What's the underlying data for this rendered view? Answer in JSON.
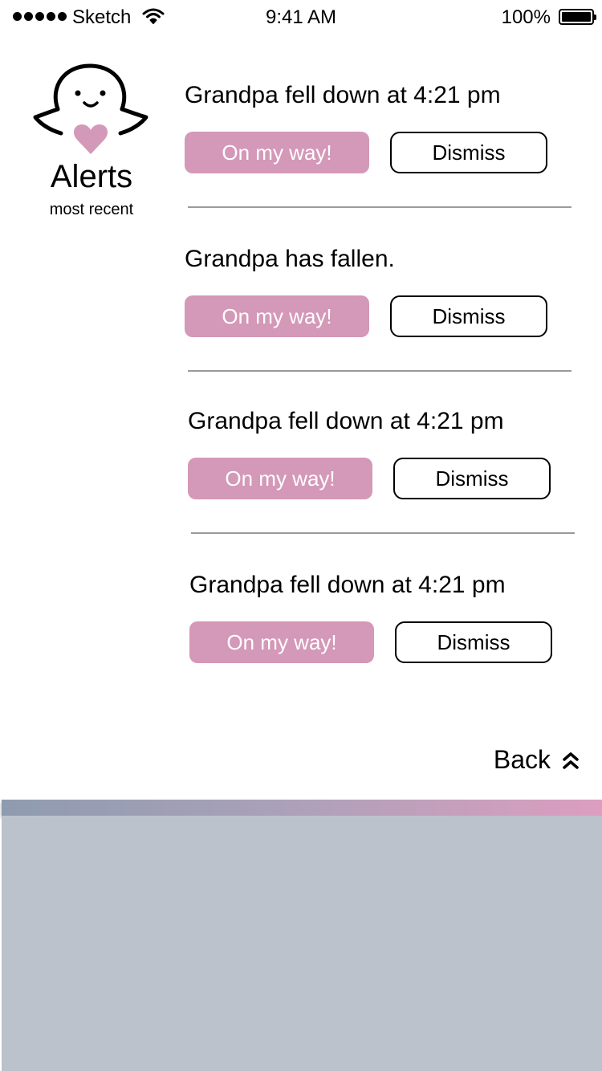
{
  "status_bar": {
    "carrier": "Sketch",
    "time": "9:41 AM",
    "battery": "100%"
  },
  "header": {
    "title": "Alerts",
    "subtitle": "most recent",
    "logo_icon": "ghost-heart-icon"
  },
  "alerts": [
    {
      "message": "Grandpa fell down at 4:21 pm",
      "primary_label": "On my way!",
      "secondary_label": "Dismiss"
    },
    {
      "message": "Grandpa has fallen.",
      "primary_label": "On my way!",
      "secondary_label": "Dismiss"
    },
    {
      "message": "Grandpa fell down at 4:21 pm",
      "primary_label": "On my way!",
      "secondary_label": "Dismiss"
    },
    {
      "message": "Grandpa fell down at 4:21 pm",
      "primary_label": "On my way!",
      "secondary_label": "Dismiss"
    }
  ],
  "footer": {
    "back_label": "Back",
    "back_icon": "double-chevron-up-icon"
  },
  "colors": {
    "primary_button": "#d498b8",
    "panel": "#bcc2cb",
    "gradient_start": "#8f9bb0",
    "gradient_end": "#dc9ec0"
  }
}
